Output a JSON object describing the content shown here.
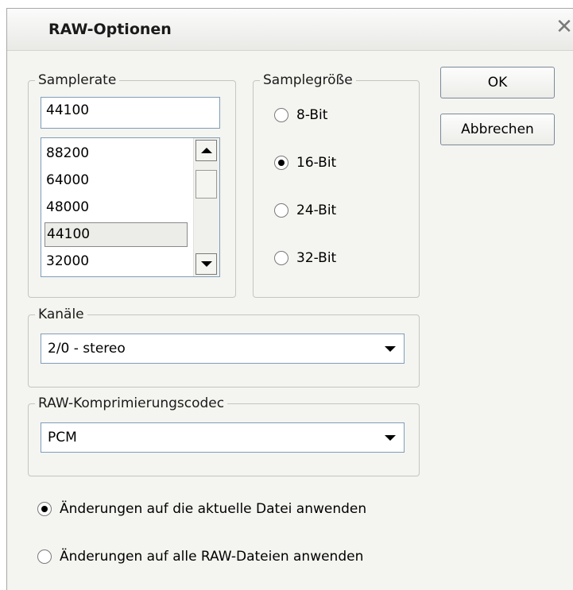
{
  "dialog": {
    "title": "RAW-Optionen",
    "close_glyph": "✕"
  },
  "samplerate": {
    "legend": "Samplerate",
    "value": "44100",
    "list": [
      "88200",
      "64000",
      "48000",
      "44100",
      "32000"
    ],
    "selected": "44100"
  },
  "samplesize": {
    "legend": "Samplegröße",
    "options": [
      "8-Bit",
      "16-Bit",
      "24-Bit",
      "32-Bit"
    ],
    "selected": "16-Bit"
  },
  "buttons": {
    "ok": "OK",
    "cancel": "Abbrechen"
  },
  "channels": {
    "legend": "Kanäle",
    "value": "2/0 - stereo"
  },
  "codec": {
    "legend": "RAW-Komprimierungscodec",
    "value": "PCM"
  },
  "apply": {
    "options": [
      "Änderungen auf die aktuelle Datei anwenden",
      "Änderungen auf alle RAW-Dateien anwenden"
    ],
    "selected": "Änderungen auf die aktuelle Datei anwenden"
  },
  "icons": {
    "close": "close-icon",
    "scroll_up": "arrow-up-icon",
    "scroll_down": "arrow-down-icon",
    "dropdown": "chevron-down-icon"
  }
}
